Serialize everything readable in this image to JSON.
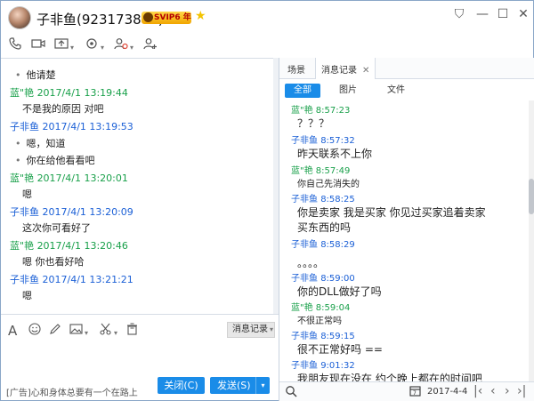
{
  "window": {
    "title": "子非鱼(923173805)",
    "vip_badge": "SVIP6 年",
    "controls": {
      "skin": "⛉",
      "minimize": "—",
      "maximize": "☐",
      "close": "✕"
    }
  },
  "toolbar": {
    "icons": [
      "phone-icon",
      "video-icon",
      "screen-share-icon",
      "remote-assist-icon",
      "block-user-icon",
      "add-friend-icon"
    ]
  },
  "chat": {
    "messages": [
      {
        "kind": "bullet",
        "text": "他请楚"
      },
      {
        "kind": "header",
        "sender": "蓝\"艳",
        "time": "2017/4/1 13:19:44",
        "color": "green"
      },
      {
        "kind": "text",
        "text": "不是我的原因 对吧"
      },
      {
        "kind": "header",
        "sender": "子非鱼",
        "time": "2017/4/1 13:19:53",
        "color": "blue"
      },
      {
        "kind": "bullet",
        "text": "嗯，知道"
      },
      {
        "kind": "bullet",
        "text": "你在给他看看吧"
      },
      {
        "kind": "header",
        "sender": "蓝\"艳",
        "time": "2017/4/1 13:20:01",
        "color": "green"
      },
      {
        "kind": "text",
        "text": "嗯"
      },
      {
        "kind": "header",
        "sender": "子非鱼",
        "time": "2017/4/1 13:20:09",
        "color": "blue"
      },
      {
        "kind": "text",
        "text": "这次你可看好了"
      },
      {
        "kind": "header",
        "sender": "蓝\"艳",
        "time": "2017/4/1 13:20:46",
        "color": "green"
      },
      {
        "kind": "text",
        "text": "嗯 你也看好哈"
      },
      {
        "kind": "header",
        "sender": "子非鱼",
        "time": "2017/4/1 13:21:21",
        "color": "blue"
      },
      {
        "kind": "text",
        "text": "嗯"
      }
    ]
  },
  "input_toolbar": {
    "icons": [
      "font-icon",
      "emoji-icon",
      "pen-icon",
      "image-icon",
      "screenshot-icon",
      "trash-icon"
    ],
    "history_button": "消息记录"
  },
  "ad_text": "[广告]心和身体总要有一个在路上",
  "buttons": {
    "close": "关闭(C)",
    "send": "发送(S)"
  },
  "right_panel": {
    "tabs": [
      {
        "label": "场景"
      },
      {
        "label": "消息记录"
      }
    ],
    "filters": [
      {
        "label": "全部"
      },
      {
        "label": "图片"
      },
      {
        "label": "文件"
      }
    ],
    "messages": [
      {
        "sender": "蓝\"艳",
        "time": "8:57:23",
        "color": "green",
        "text": "？？？",
        "size": "normal"
      },
      {
        "sender": "子非鱼",
        "time": "8:57:32",
        "color": "blue",
        "text": "昨天联系不上你",
        "size": "normal"
      },
      {
        "sender": "蓝\"艳",
        "time": "8:57:49",
        "color": "green",
        "text": "你自己先消失的",
        "size": "small"
      },
      {
        "sender": "子非鱼",
        "time": "8:58:25",
        "color": "blue",
        "text": "你是卖家   我是买家   你见过买家追着卖家",
        "text2": "买东西的吗",
        "size": "normal"
      },
      {
        "sender": "子非鱼",
        "time": "8:58:29",
        "color": "blue",
        "text": "。。。。",
        "size": "normal"
      },
      {
        "sender": "子非鱼",
        "time": "8:59:00",
        "color": "blue",
        "text": "你的DLL做好了吗",
        "size": "normal"
      },
      {
        "sender": "蓝\"艳",
        "time": "8:59:04",
        "color": "green",
        "text": "不很正常吗",
        "size": "small"
      },
      {
        "sender": "子非鱼",
        "time": "8:59:15",
        "color": "blue",
        "text": "很不正常好吗   ==",
        "size": "normal"
      },
      {
        "sender": "子非鱼",
        "time": "9:01:32",
        "color": "blue",
        "text": "我朋友现在没在   约个晚上都在的时间吧",
        "size": "normal"
      }
    ],
    "date": "2017-4-4"
  },
  "colors": {
    "accent": "#1a8ce8",
    "sender_green": "#19a04a",
    "sender_blue": "#1a5fd6"
  }
}
